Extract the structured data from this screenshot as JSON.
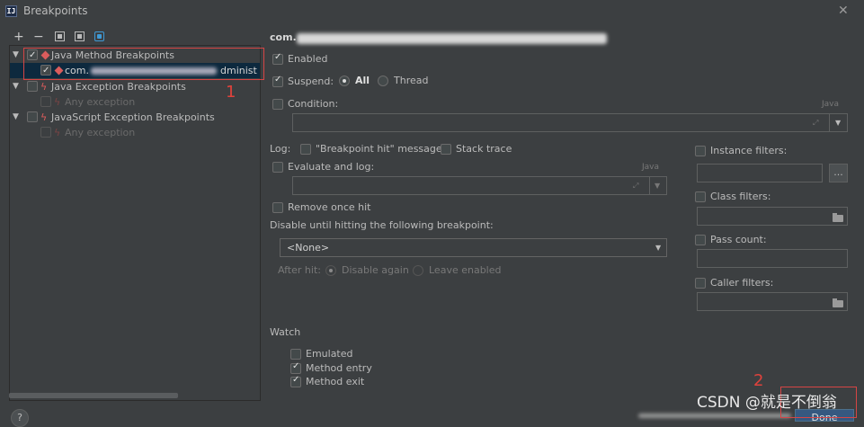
{
  "window": {
    "title": "Breakpoints",
    "app_icon_text": "IJ",
    "close_glyph": "✕"
  },
  "toolbar": {
    "add": "+",
    "remove": "−"
  },
  "tree": {
    "groups": [
      {
        "label": "Java Method Breakpoints",
        "checked": true,
        "icon": "diamond-icon"
      },
      {
        "label": "Java Exception Breakpoints",
        "checked": false,
        "icon": "bolt-icon"
      },
      {
        "label": "JavaScript Exception Breakpoints",
        "checked": false,
        "icon": "bolt-icon"
      }
    ],
    "selected_item": {
      "prefix": "com.",
      "suffix": "dminist",
      "checked": true
    },
    "any_exception_1": "Any exception",
    "any_exception_2": "Any exception"
  },
  "annotations": {
    "marker_1": "1",
    "marker_2": "2",
    "watermark": "CSDN @就是不倒翁"
  },
  "details": {
    "header_prefix": "com.",
    "enabled_label": "Enabled",
    "suspend_label": "Suspend:",
    "suspend_all": "All",
    "suspend_thread": "Thread",
    "condition_label": "Condition:",
    "lang_java": "Java",
    "lang_java_2": "Java",
    "log_label": "Log:",
    "log_message": "\"Breakpoint hit\" message",
    "stack_trace": "Stack trace",
    "evaluate_label": "Evaluate and log:",
    "remove_once_hit": "Remove once hit",
    "disable_until": "Disable until hitting the following breakpoint:",
    "disable_select_value": "<None>",
    "after_hit": "After hit:",
    "disable_again": "Disable again",
    "leave_enabled": "Leave enabled",
    "watch_title": "Watch",
    "watch_emulated": "Emulated",
    "watch_method_entry": "Method entry",
    "watch_method_exit": "Method exit"
  },
  "filters": {
    "instance": "Instance filters:",
    "class": "Class filters:",
    "pass_count": "Pass count:",
    "caller": "Caller filters:",
    "ellipsis": "..."
  },
  "footer": {
    "help": "?",
    "done_partial": "Done"
  }
}
